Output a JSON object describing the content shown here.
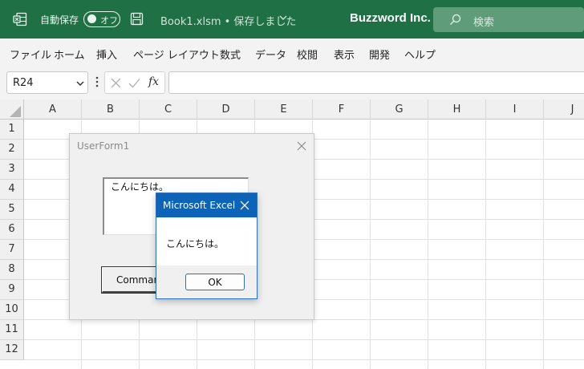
{
  "titlebar": {
    "autosave_label": "自動保存",
    "autosave_state": "オフ",
    "document_name": "Book1.xlsm • 保存しました",
    "company": "Buzzword Inc.",
    "search_placeholder": "検索",
    "background_color": "#1f7145"
  },
  "menu": {
    "items": [
      "ファイル",
      "ホーム",
      "挿入",
      "ページ レイアウト",
      "数式",
      "データ",
      "校閲",
      "表示",
      "開発",
      "ヘルプ"
    ]
  },
  "formula_bar": {
    "name_box": "R24",
    "fx_label": "fx",
    "formula": ""
  },
  "sheet": {
    "columns": [
      "A",
      "B",
      "C",
      "D",
      "E",
      "F",
      "G",
      "H",
      "I",
      "J"
    ],
    "rows": [
      "1",
      "2",
      "3",
      "4",
      "5",
      "6",
      "7",
      "8",
      "9",
      "10",
      "11",
      "12"
    ]
  },
  "userform": {
    "title": "UserForm1",
    "textbox_value": "こんにちは。",
    "button_label": "Command"
  },
  "msgbox": {
    "title": "Microsoft Excel",
    "message": "こんにちは。",
    "ok_label": "OK",
    "accent_color": "#0d63b7"
  }
}
